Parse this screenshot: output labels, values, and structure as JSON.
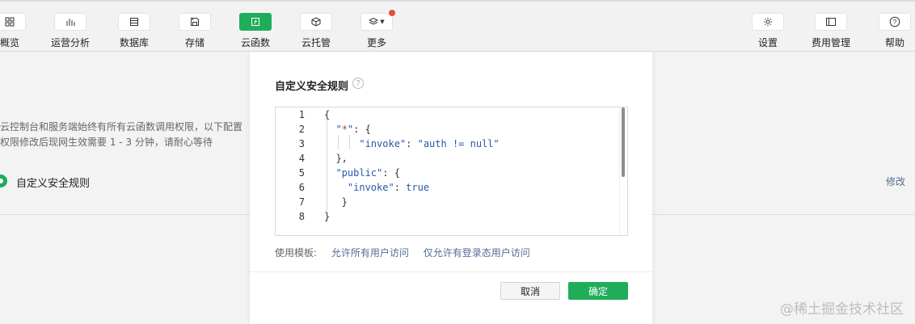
{
  "toolbar": {
    "left": [
      {
        "label": "概览",
        "icon": "grid-icon"
      },
      {
        "label": "运营分析",
        "icon": "bar-chart-icon"
      },
      {
        "label": "数据库",
        "icon": "database-icon"
      },
      {
        "label": "存储",
        "icon": "save-icon"
      },
      {
        "label": "云函数",
        "icon": "cloud-function-icon",
        "active": true
      },
      {
        "label": "云托管",
        "icon": "cube-icon"
      },
      {
        "label": "更多",
        "icon": "layers-icon",
        "has_notification": true
      }
    ],
    "right": [
      {
        "label": "设置",
        "icon": "gear-icon"
      },
      {
        "label": "费用管理",
        "icon": "billing-icon"
      },
      {
        "label": "帮助",
        "icon": "help-icon"
      }
    ]
  },
  "background": {
    "desc_line1": "云控制台和服务端始终有所有云函数调用权限，以下配置",
    "desc_line2": "权限修改后现网生效需要 1 - 3 分钟，请耐心等待",
    "rule_label": "自定义安全规则",
    "edit_link": "修改"
  },
  "modal": {
    "title": "自定义安全规则",
    "help_glyph": "?",
    "editor": {
      "line_numbers": [
        "1",
        "2",
        "3",
        "4",
        "5",
        "6",
        "7",
        "8"
      ]
    },
    "template_label": "使用模板:",
    "template_links": [
      "允许所有用户访问",
      "仅允许有登录态用户访问"
    ],
    "cancel_label": "取消",
    "confirm_label": "确定"
  },
  "watermark": "@稀土掘金技术社区",
  "colors": {
    "accent_green": "#1fad5a",
    "link_blue": "#576b95",
    "notification_red": "#e74c3c"
  }
}
